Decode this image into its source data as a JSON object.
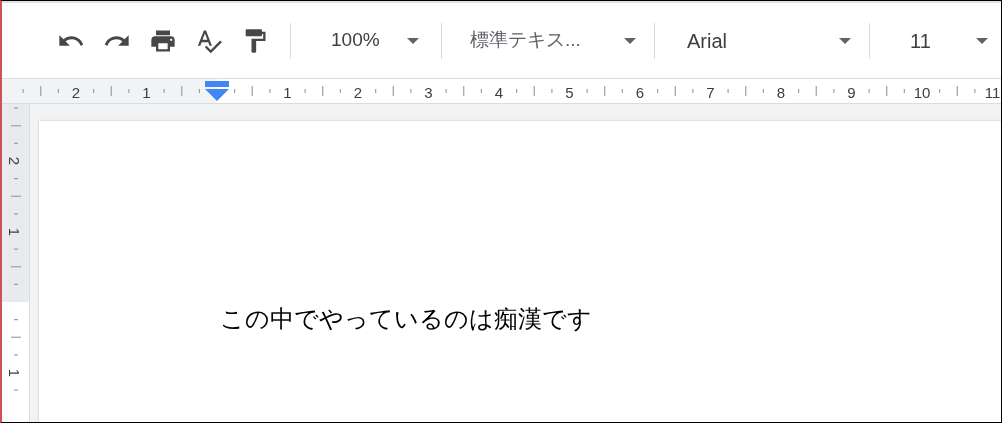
{
  "toolbar": {
    "zoom": "100%",
    "style": "標準テキス...",
    "font": "Arial",
    "size": "11"
  },
  "ruler": {
    "left_labels": [
      "2",
      "1"
    ],
    "right_labels": [
      "1",
      "2",
      "3",
      "4",
      "5",
      "6",
      "7",
      "8",
      "9",
      "10",
      "11"
    ]
  },
  "vertical_ruler": {
    "top_labels": [
      "2",
      "1"
    ],
    "bottom_labels": [
      "1"
    ]
  },
  "document": {
    "text": "この中でやっているのは痴漢です"
  }
}
